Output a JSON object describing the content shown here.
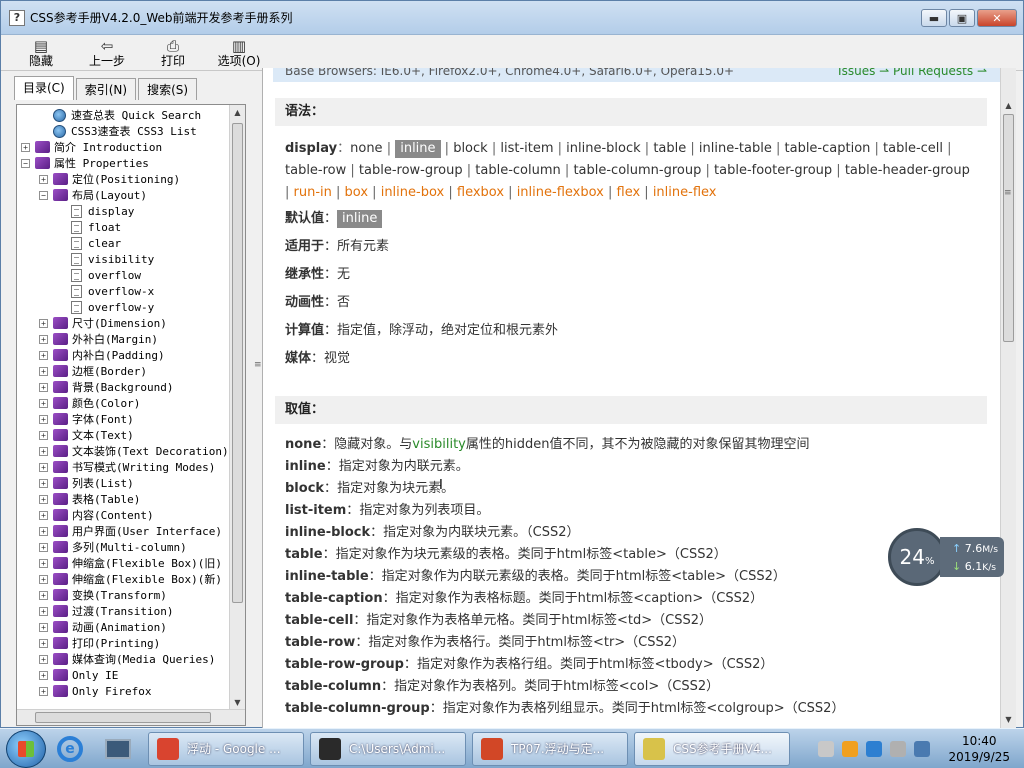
{
  "window": {
    "title": "CSS参考手册V4.2.0_Web前端开发参考手册系列",
    "controls": {
      "minimize": "▬",
      "maximize": "▣",
      "close": "✕"
    }
  },
  "toolbar": [
    {
      "icon": "▤",
      "label": "隐藏"
    },
    {
      "icon": "⇦",
      "label": "上一步"
    },
    {
      "icon": "⎙",
      "label": "打印"
    },
    {
      "icon": "▥",
      "label": "选项(O)"
    }
  ],
  "tabs": [
    {
      "label": "目录(C)"
    },
    {
      "label": "索引(N)"
    },
    {
      "label": "搜索(S)"
    }
  ],
  "tree": [
    {
      "label": "速查总表 Quick Search",
      "level": 1,
      "icon": "help",
      "expander": ""
    },
    {
      "label": "CSS3速查表 CSS3 List",
      "level": 1,
      "icon": "help",
      "expander": ""
    },
    {
      "label": "简介 Introduction",
      "level": 0,
      "icon": "book",
      "expander": "+"
    },
    {
      "label": "属性 Properties",
      "level": 0,
      "icon": "book",
      "expander": "−"
    },
    {
      "label": "定位(Positioning)",
      "level": 1,
      "icon": "book",
      "expander": "+"
    },
    {
      "label": "布局(Layout)",
      "level": 1,
      "icon": "book",
      "expander": "−"
    },
    {
      "label": "display",
      "level": 2,
      "icon": "page",
      "expander": ""
    },
    {
      "label": "float",
      "level": 2,
      "icon": "page",
      "expander": ""
    },
    {
      "label": "clear",
      "level": 2,
      "icon": "page",
      "expander": ""
    },
    {
      "label": "visibility",
      "level": 2,
      "icon": "page",
      "expander": ""
    },
    {
      "label": "overflow",
      "level": 2,
      "icon": "page",
      "expander": ""
    },
    {
      "label": "overflow-x",
      "level": 2,
      "icon": "page",
      "expander": ""
    },
    {
      "label": "overflow-y",
      "level": 2,
      "icon": "page",
      "expander": ""
    },
    {
      "label": "尺寸(Dimension)",
      "level": 1,
      "icon": "book",
      "expander": "+"
    },
    {
      "label": "外补白(Margin)",
      "level": 1,
      "icon": "book",
      "expander": "+"
    },
    {
      "label": "内补白(Padding)",
      "level": 1,
      "icon": "book",
      "expander": "+"
    },
    {
      "label": "边框(Border)",
      "level": 1,
      "icon": "book",
      "expander": "+"
    },
    {
      "label": "背景(Background)",
      "level": 1,
      "icon": "book",
      "expander": "+"
    },
    {
      "label": "颜色(Color)",
      "level": 1,
      "icon": "book",
      "expander": "+"
    },
    {
      "label": "字体(Font)",
      "level": 1,
      "icon": "book",
      "expander": "+"
    },
    {
      "label": "文本(Text)",
      "level": 1,
      "icon": "book",
      "expander": "+"
    },
    {
      "label": "文本装饰(Text Decoration)",
      "level": 1,
      "icon": "book",
      "expander": "+"
    },
    {
      "label": "书写模式(Writing Modes)",
      "level": 1,
      "icon": "book",
      "expander": "+"
    },
    {
      "label": "列表(List)",
      "level": 1,
      "icon": "book",
      "expander": "+"
    },
    {
      "label": "表格(Table)",
      "level": 1,
      "icon": "book",
      "expander": "+"
    },
    {
      "label": "内容(Content)",
      "level": 1,
      "icon": "book",
      "expander": "+"
    },
    {
      "label": "用户界面(User Interface)",
      "level": 1,
      "icon": "book",
      "expander": "+"
    },
    {
      "label": "多列(Multi-column)",
      "level": 1,
      "icon": "book",
      "expander": "+"
    },
    {
      "label": "伸缩盒(Flexible Box)(旧)",
      "level": 1,
      "icon": "book",
      "expander": "+"
    },
    {
      "label": "伸缩盒(Flexible Box)(新)",
      "level": 1,
      "icon": "book",
      "expander": "+"
    },
    {
      "label": "变换(Transform)",
      "level": 1,
      "icon": "book",
      "expander": "+"
    },
    {
      "label": "过渡(Transition)",
      "level": 1,
      "icon": "book",
      "expander": "+"
    },
    {
      "label": "动画(Animation)",
      "level": 1,
      "icon": "book",
      "expander": "+"
    },
    {
      "label": "打印(Printing)",
      "level": 1,
      "icon": "book",
      "expander": "+"
    },
    {
      "label": "媒体查询(Media Queries)",
      "level": 1,
      "icon": "book",
      "expander": "+"
    },
    {
      "label": "Only IE",
      "level": 1,
      "icon": "book",
      "expander": "+"
    },
    {
      "label": "Only Firefox",
      "level": 1,
      "icon": "book",
      "expander": "+"
    }
  ],
  "content": {
    "top_strip_text": "Base Browsers: IE6.0+, Firefox2.0+, Chrome4.0+, Safari6.0+, Opera15.0+",
    "top_strip_links": "Issues ⇀ Pull Requests ⇀",
    "syntax_heading": "语法：",
    "syntax": {
      "property": "display",
      "colon": "：",
      "tokens": [
        {
          "text": "none",
          "style": "normal"
        },
        {
          "text": "inline",
          "style": "highlight"
        },
        {
          "text": "block",
          "style": "normal"
        },
        {
          "text": "list-item",
          "style": "normal"
        },
        {
          "text": "inline-block",
          "style": "normal"
        },
        {
          "text": "table",
          "style": "normal"
        },
        {
          "text": "inline-table",
          "style": "normal"
        },
        {
          "text": "table-caption",
          "style": "normal"
        },
        {
          "text": "table-cell",
          "style": "normal"
        },
        {
          "text": "table-row",
          "style": "normal"
        },
        {
          "text": "table-row-group",
          "style": "normal"
        },
        {
          "text": "table-column",
          "style": "normal"
        },
        {
          "text": "table-column-group",
          "style": "normal"
        },
        {
          "text": "table-footer-group",
          "style": "normal"
        },
        {
          "text": "table-header-group",
          "style": "normal"
        },
        {
          "text": "run-in",
          "style": "orange"
        },
        {
          "text": "box",
          "style": "orange"
        },
        {
          "text": "inline-box",
          "style": "orange"
        },
        {
          "text": "flexbox",
          "style": "orange"
        },
        {
          "text": "inline-flexbox",
          "style": "orange"
        },
        {
          "text": "flex",
          "style": "orange"
        },
        {
          "text": "inline-flex",
          "style": "orange"
        }
      ]
    },
    "properties": [
      {
        "label": "默认值",
        "value": "inline",
        "highlight": true
      },
      {
        "label": "适用于",
        "value": "所有元素",
        "highlight": false
      },
      {
        "label": "继承性",
        "value": "无",
        "highlight": false
      },
      {
        "label": "动画性",
        "value": "否",
        "highlight": false
      },
      {
        "label": "计算值",
        "value": "指定值，除浮动，绝对定位和根元素外",
        "highlight": false
      },
      {
        "label": "媒体",
        "value": "视觉",
        "highlight": false
      }
    ],
    "prop_colon": "：",
    "values_heading": "取值：",
    "values": [
      {
        "name": "none",
        "pre": "隐藏对象。与",
        "link": "visibility",
        "desc": "属性的hidden值不同，其不为被隐藏的对象保留其物理空间"
      },
      {
        "name": "inline",
        "pre": "",
        "link": "",
        "desc": "指定对象为内联元素。"
      },
      {
        "name": "block",
        "pre": "",
        "link": "",
        "desc": "指定对象为块元素。"
      },
      {
        "name": "list-item",
        "pre": "",
        "link": "",
        "desc": "指定对象为列表项目。"
      },
      {
        "name": "inline-block",
        "pre": "",
        "link": "",
        "desc": "指定对象为内联块元素。（CSS2）"
      },
      {
        "name": "table",
        "pre": "",
        "link": "",
        "desc": "指定对象作为块元素级的表格。类同于html标签<table>（CSS2）"
      },
      {
        "name": "inline-table",
        "pre": "",
        "link": "",
        "desc": "指定对象作为内联元素级的表格。类同于html标签<table>（CSS2）"
      },
      {
        "name": "table-caption",
        "pre": "",
        "link": "",
        "desc": "指定对象作为表格标题。类同于html标签<caption>（CSS2）"
      },
      {
        "name": "table-cell",
        "pre": "",
        "link": "",
        "desc": "指定对象作为表格单元格。类同于html标签<td>（CSS2）"
      },
      {
        "name": "table-row",
        "pre": "",
        "link": "",
        "desc": "指定对象作为表格行。类同于html标签<tr>（CSS2）"
      },
      {
        "name": "table-row-group",
        "pre": "",
        "link": "",
        "desc": "指定对象作为表格行组。类同于html标签<tbody>（CSS2）"
      },
      {
        "name": "table-column",
        "pre": "",
        "link": "",
        "desc": "指定对象作为表格列。类同于html标签<col>（CSS2）"
      },
      {
        "name": "table-column-group",
        "pre": "",
        "link": "",
        "desc": "指定对象作为表格列组显示。类同于html标签<colgroup>（CSS2）"
      }
    ],
    "value_colon": "："
  },
  "speed_widget": {
    "percent": "24",
    "percent_unit": "%",
    "upload": "7.6",
    "upload_unit": "M/s",
    "download": "6.1",
    "download_unit": "K/s"
  },
  "taskbar": {
    "tasks": [
      {
        "label": "浮动 - Google ...",
        "icon": "chrome-icon",
        "color": "#d9442f"
      },
      {
        "label": "C:\\Users\\Admi...",
        "icon": "console-icon",
        "color": "#2a2a2a"
      },
      {
        "label": "TP07.浮动与定...",
        "icon": "powerpoint-icon",
        "color": "#d24726"
      },
      {
        "label": "CSS参考手册V4...",
        "icon": "help-viewer-icon",
        "color": "#d8c24a"
      }
    ],
    "clock_time": "10:40",
    "clock_date": "2019/9/25"
  },
  "colors": {
    "highlight": "#8a8a8a",
    "orange_value": "#e2720b",
    "link_green": "#2a8a2a"
  }
}
